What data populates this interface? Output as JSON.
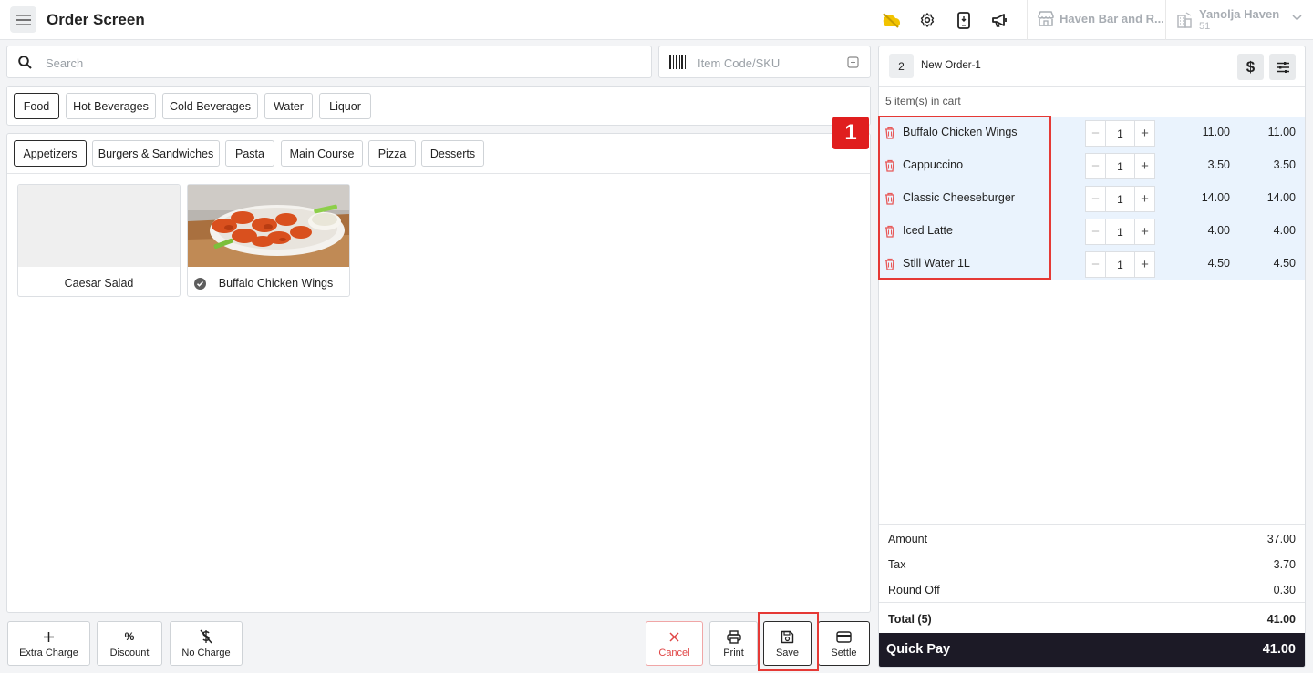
{
  "header": {
    "title": "Order Screen",
    "outlet_name": "Haven Bar and R...",
    "user_name": "Yanolja Haven",
    "user_sub": "51"
  },
  "search": {
    "placeholder": "Search"
  },
  "sku": {
    "placeholder": "Item Code/SKU"
  },
  "categories": [
    "Food",
    "Hot Beverages",
    "Cold Beverages",
    "Water",
    "Liquor"
  ],
  "subcategories": [
    "Appetizers",
    "Burgers & Sandwiches",
    "Pasta",
    "Main Course",
    "Pizza",
    "Desserts"
  ],
  "menu_items": [
    {
      "label": "Caesar Salad",
      "selected": false
    },
    {
      "label": "Buffalo Chicken Wings",
      "selected": true
    }
  ],
  "actions": {
    "extra_charge": "Extra Charge",
    "discount": "Discount",
    "discount_symbol": "%",
    "no_charge": "No Charge",
    "cancel": "Cancel",
    "print": "Print",
    "save": "Save",
    "settle": "Settle"
  },
  "cart": {
    "order_number": "2",
    "order_name": "New Order-1",
    "count_text": "5 item(s) in cart",
    "items": [
      {
        "name": "Buffalo Chicken Wings",
        "qty": "1",
        "price": "11.00",
        "total": "11.00"
      },
      {
        "name": "Cappuccino",
        "qty": "1",
        "price": "3.50",
        "total": "3.50"
      },
      {
        "name": "Classic Cheeseburger",
        "qty": "1",
        "price": "14.00",
        "total": "14.00"
      },
      {
        "name": "Iced Latte",
        "qty": "1",
        "price": "4.00",
        "total": "4.00"
      },
      {
        "name": "Still Water 1L",
        "qty": "1",
        "price": "4.50",
        "total": "4.50"
      }
    ],
    "amount_label": "Amount",
    "amount": "37.00",
    "tax_label": "Tax",
    "tax": "3.70",
    "roundoff_label": "Round Off",
    "roundoff": "0.30",
    "total_label": "Total (5)",
    "total": "41.00",
    "quick_pay_label": "Quick Pay",
    "quick_pay": "41.00"
  },
  "annotation": {
    "badge": "1"
  },
  "colors": {
    "accent_red": "#e53935",
    "quick_pay_bg": "#1c1a26",
    "cart_row_bg": "#eaf3fd"
  }
}
